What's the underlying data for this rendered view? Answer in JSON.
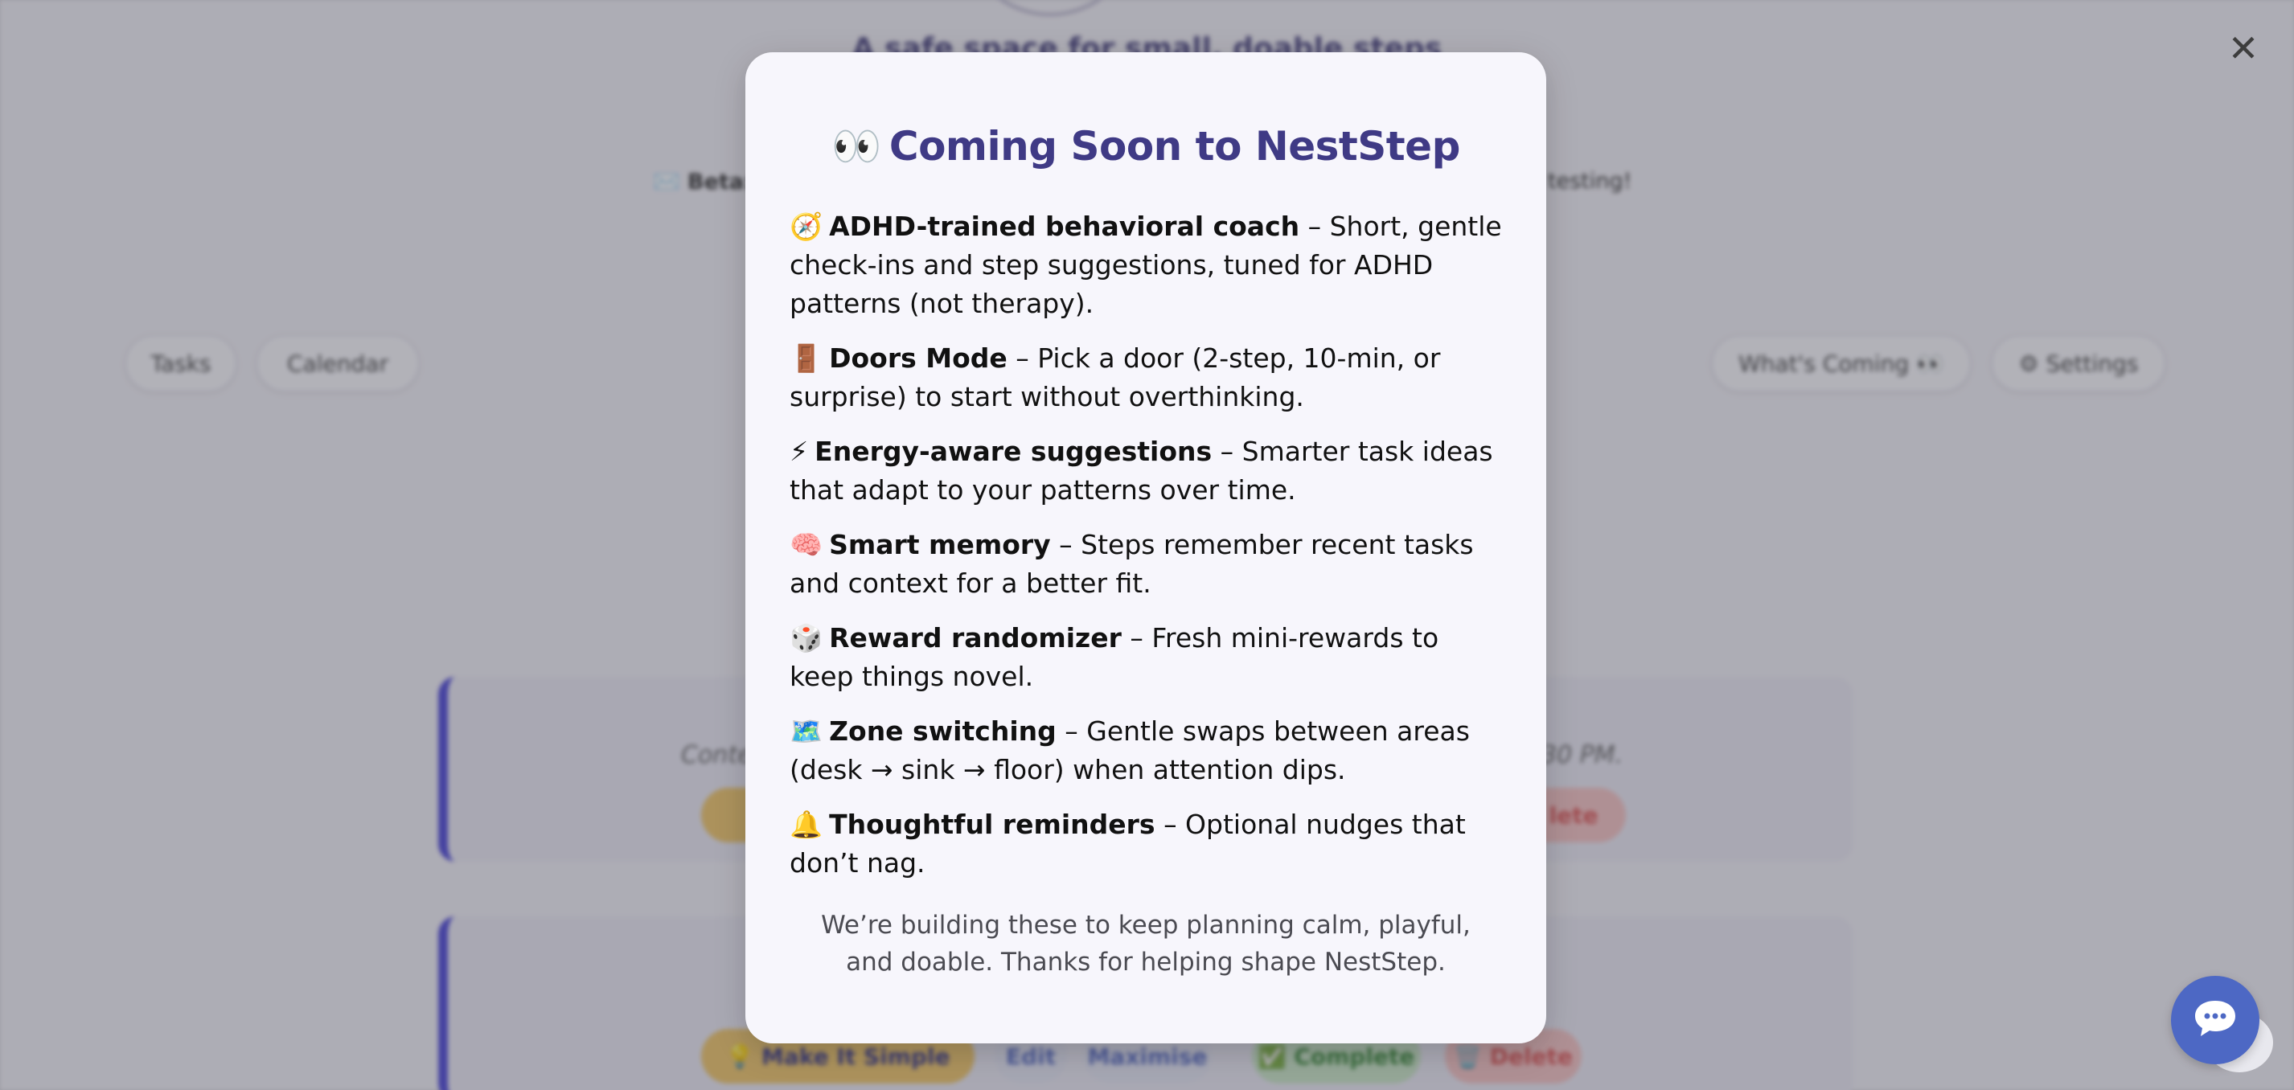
{
  "background": {
    "tagline": "A safe space for small, doable steps",
    "beta_label": "✉️ Beta:",
    "beta_right": "testing!",
    "nav": {
      "tasks": "Tasks",
      "calendar": "Calendar",
      "whats_coming": "What's Coming 👀",
      "settings": "⚙ Settings"
    },
    "card1_text_left": "Conte",
    "card1_text_right": "30 PM.",
    "card1_delete": "lete",
    "card2_buttons": {
      "make_simple": "💡 Make It Simple",
      "edit": "Edit",
      "maximise": "Maximise",
      "complete": "✅ Complete",
      "delete": "🗑️ Delete"
    }
  },
  "modal": {
    "title_emoji": "👀",
    "title": "Coming Soon to NestStep",
    "features": [
      {
        "icon": "🧭",
        "name": "ADHD-trained behavioral coach",
        "desc": " – Short, gentle check-ins and step suggestions, tuned for ADHD patterns (not therapy)."
      },
      {
        "icon": "🚪",
        "name": "Doors Mode",
        "desc": " – Pick a door (2-step, 10-min, or surprise) to start without overthinking."
      },
      {
        "icon": "⚡",
        "name": "Energy-aware suggestions",
        "desc": " – Smarter task ideas that adapt to your patterns over time."
      },
      {
        "icon": "🧠",
        "name": "Smart memory",
        "desc": " – Steps remember recent tasks and context for a better fit."
      },
      {
        "icon": "🎲",
        "name": "Reward randomizer",
        "desc": " – Fresh mini-rewards to keep things novel."
      },
      {
        "icon": "🗺️",
        "name": "Zone switching",
        "desc": " – Gentle swaps between areas (desk → sink → floor) when attention dips."
      },
      {
        "icon": "🔔",
        "name": "Thoughtful reminders",
        "desc": " – Optional nudges that don’t nag."
      }
    ],
    "footer": "We’re building these to keep planning calm, playful, and doable. Thanks for helping shape NestStep.",
    "close_symbol": "✕"
  },
  "colors": {
    "title": "#3f3a85",
    "accent": "#4b46d8",
    "chat_fab": "#4d68c4"
  },
  "icons": {
    "close": "close-icon",
    "chat": "chat-bubble-icon"
  }
}
